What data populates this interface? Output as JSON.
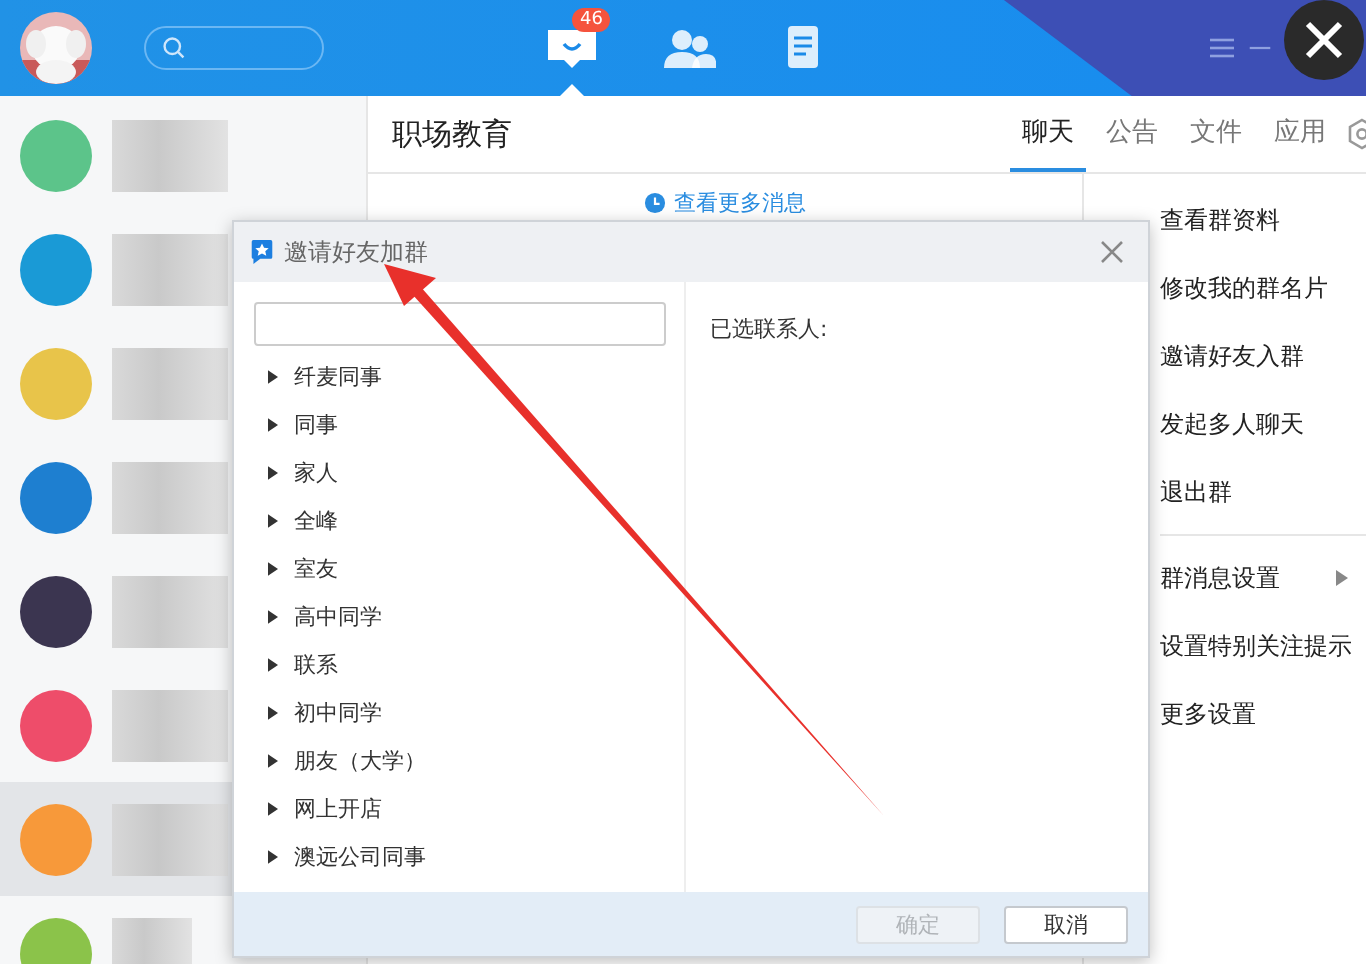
{
  "top_bar": {
    "badge": "46",
    "nav": [
      {
        "kind": "chat",
        "selected": true
      },
      {
        "kind": "contacts",
        "selected": false
      },
      {
        "kind": "notes",
        "selected": false
      }
    ]
  },
  "conversations": [
    {
      "color": "#5cc48a",
      "selected": false
    },
    {
      "color": "#1a9ad6",
      "selected": false
    },
    {
      "color": "#e8c44a",
      "selected": false
    },
    {
      "color": "#1e7fd0",
      "selected": false
    },
    {
      "color": "#3b3550",
      "selected": false
    },
    {
      "color": "#ee4d6a",
      "selected": false
    },
    {
      "color": "#f7993a",
      "selected": true
    },
    {
      "color": "#8bc34a",
      "selected": false
    }
  ],
  "chat": {
    "title": "职场教育",
    "tabs": [
      {
        "label": "聊天",
        "selected": true
      },
      {
        "label": "公告",
        "selected": false
      },
      {
        "label": "文件",
        "selected": false
      },
      {
        "label": "应用",
        "selected": false
      }
    ],
    "more_link": "查看更多消息"
  },
  "group_menu": {
    "sections": [
      [
        {
          "label": "查看群资料",
          "has_submenu": false
        },
        {
          "label": "修改我的群名片",
          "has_submenu": false
        },
        {
          "label": "邀请好友入群",
          "has_submenu": false
        },
        {
          "label": "发起多人聊天",
          "has_submenu": false
        },
        {
          "label": "退出群",
          "has_submenu": false
        }
      ],
      [
        {
          "label": "群消息设置",
          "has_submenu": true
        },
        {
          "label": "设置特别关注提示",
          "has_submenu": false
        },
        {
          "label": "更多设置",
          "has_submenu": false
        }
      ]
    ]
  },
  "dialog": {
    "title": "邀请好友加群",
    "groups": [
      {
        "label": "纤麦同事",
        "expanded": false
      },
      {
        "label": "同事",
        "expanded": false
      },
      {
        "label": "家人",
        "expanded": false
      },
      {
        "label": "全峰",
        "expanded": false
      },
      {
        "label": "室友",
        "expanded": false
      },
      {
        "label": "高中同学",
        "expanded": false
      },
      {
        "label": "联系",
        "expanded": false
      },
      {
        "label": "初中同学",
        "expanded": false
      },
      {
        "label": "朋友（大学）",
        "expanded": false
      },
      {
        "label": "网上开店",
        "expanded": false
      },
      {
        "label": "澳远公司同事",
        "expanded": false
      }
    ],
    "selected_label": "已选联系人:",
    "buttons": [
      {
        "label": "确定",
        "disabled": true
      },
      {
        "label": "取消",
        "disabled": false
      }
    ]
  }
}
